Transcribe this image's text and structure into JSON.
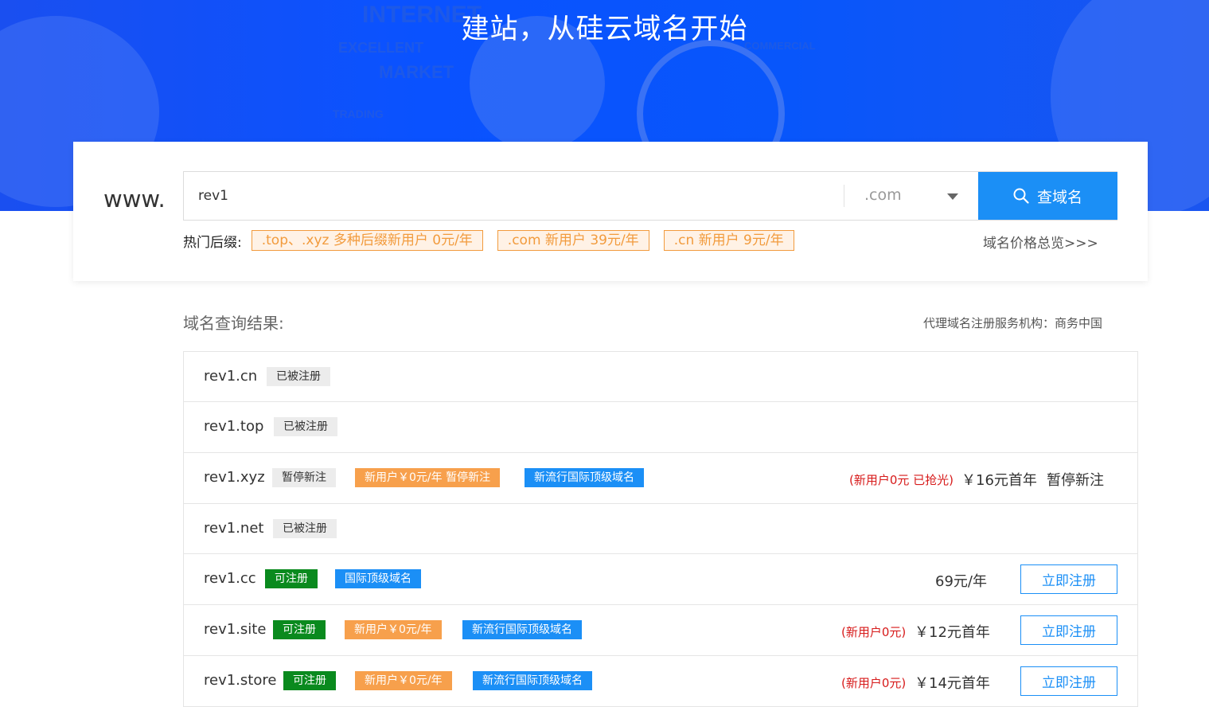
{
  "banner": {
    "title": "建站，从硅云域名开始",
    "bg_words": [
      "INTERNET",
      "EXCELLENT",
      "MARKET",
      "TRADING",
      "COMMERCIAL"
    ]
  },
  "search": {
    "prefix": "www.",
    "query": "rev1",
    "tld": ".com",
    "button_label": "查域名"
  },
  "hot": {
    "label": "热门后缀:",
    "tags": [
      ".top、.xyz 多种后缀新用户 0元/年",
      ".com 新用户 39元/年",
      ".cn 新用户 9元/年"
    ],
    "price_link": "域名价格总览>>>"
  },
  "results": {
    "heading": "域名查询结果:",
    "agency": "代理域名注册服务机构：商务中国",
    "register_label": "立即注册",
    "rows": [
      {
        "domain": "rev1.cn",
        "tags": [
          "已被注册"
        ]
      },
      {
        "domain": "rev1.top",
        "tags": [
          "已被注册"
        ]
      },
      {
        "domain": "rev1.xyz",
        "tags": [
          "暂停新注",
          "新用户￥0元/年 暂停新注",
          "新流行国际顶级域名"
        ],
        "promo": "(新用户0元 已抢光)",
        "price": "￥16元首年",
        "status": "暂停新注"
      },
      {
        "domain": "rev1.net",
        "tags": [
          "已被注册"
        ]
      },
      {
        "domain": "rev1.cc",
        "tags": [
          "可注册",
          "国际顶级域名"
        ],
        "price": "69元/年"
      },
      {
        "domain": "rev1.site",
        "tags": [
          "可注册",
          "新用户￥0元/年",
          "新流行国际顶级域名"
        ],
        "promo": "(新用户0元)",
        "price": "￥12元首年"
      },
      {
        "domain": "rev1.store",
        "tags": [
          "可注册",
          "新用户￥0元/年",
          "新流行国际顶级域名"
        ],
        "promo": "(新用户0元)",
        "price": "￥14元首年"
      }
    ]
  },
  "colors": {
    "primary": "#1b8ff6",
    "banner": "#0a52ff",
    "orange": "#f7a04c",
    "green": "#0a8a1e",
    "red": "#d71a1a"
  }
}
